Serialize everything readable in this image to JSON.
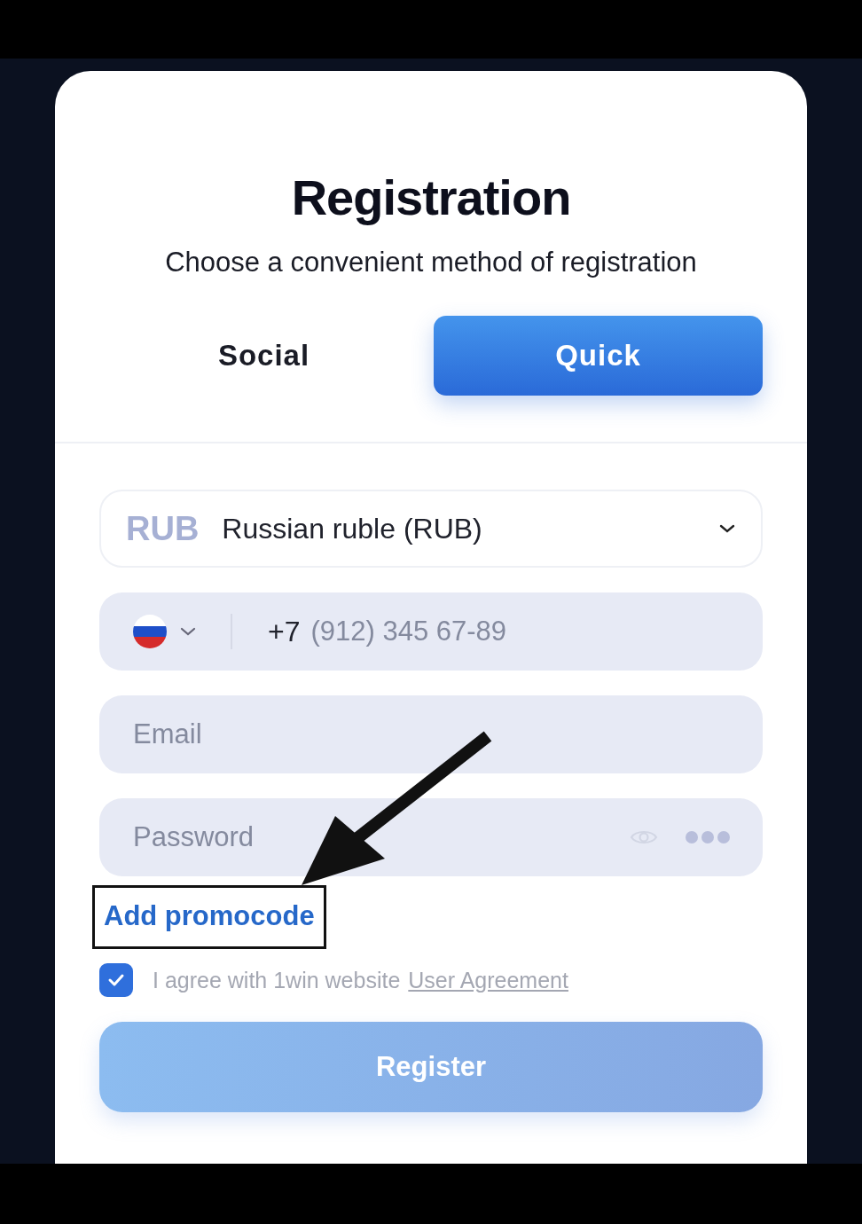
{
  "title": "Registration",
  "subtitle": "Choose a convenient method of registration",
  "tabs": [
    {
      "label": "Social",
      "selected": false
    },
    {
      "label": "Quick",
      "selected": true
    }
  ],
  "currency": {
    "code": "RUB",
    "name": "Russian ruble (RUB)"
  },
  "phone": {
    "code": "+7",
    "placeholder": "(912) 345 67-89"
  },
  "email": {
    "placeholder": "Email"
  },
  "password": {
    "placeholder": "Password"
  },
  "promocode_link": "Add promocode",
  "agreement": {
    "checked": true,
    "text": "I agree with 1win website",
    "link": "User Agreement"
  },
  "register_button": {
    "label": "Register",
    "disabled": true
  }
}
